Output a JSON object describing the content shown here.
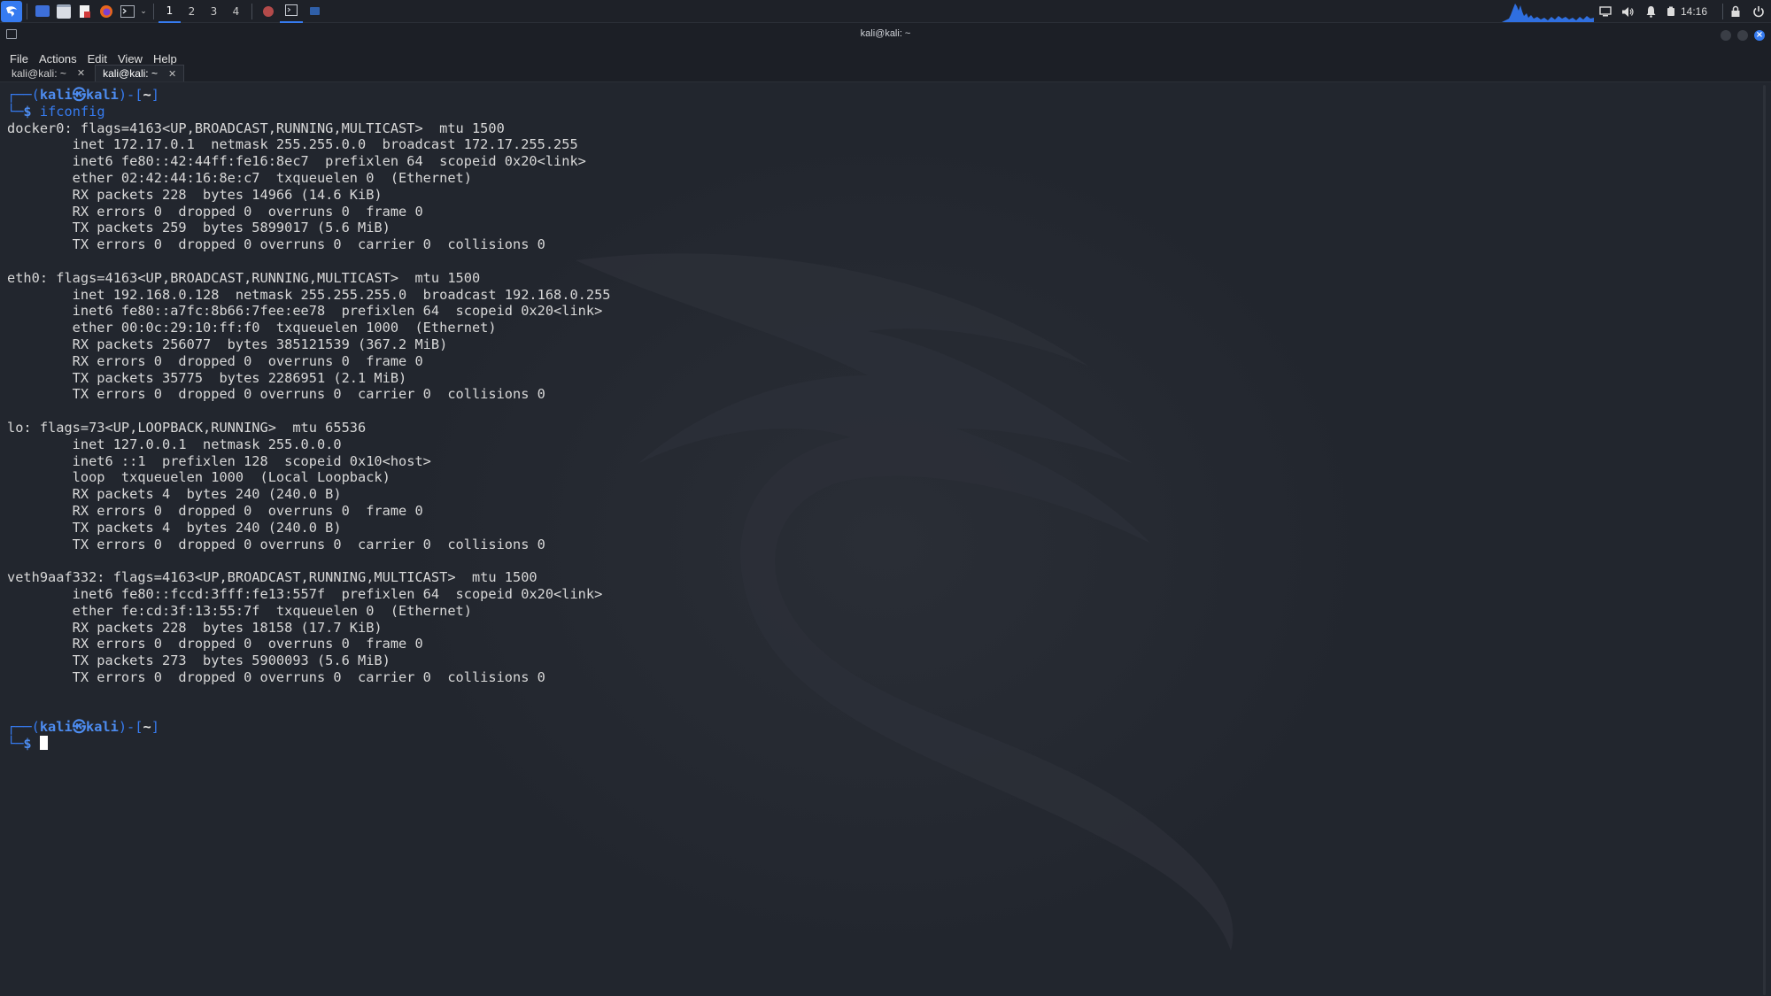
{
  "panel": {
    "workspaces": [
      "1",
      "2",
      "3",
      "4"
    ],
    "active_workspace": 0,
    "clock": "14:16",
    "colors": {
      "accent": "#367bf0",
      "background": "#1e2128"
    },
    "launchers": [
      "kali-menu-icon",
      "show-desktop-icon",
      "file-manager-icon",
      "text-editor-icon",
      "firefox-icon",
      "terminal-icon"
    ],
    "tray_icons": [
      "cpu-graph",
      "display-icon",
      "volume-icon",
      "notification-bell-icon",
      "battery-icon",
      "lock-icon",
      "power-icon"
    ]
  },
  "window": {
    "title": "kali@kali: ~",
    "menus": [
      "File",
      "Actions",
      "Edit",
      "View",
      "Help"
    ],
    "tabs": [
      {
        "label": "kali@kali: ~",
        "active": false
      },
      {
        "label": "kali@kali: ~",
        "active": true
      }
    ]
  },
  "terminal": {
    "prompt": {
      "user": "kali",
      "separator": "㉿",
      "host": "kali",
      "cwd": "~",
      "symbol": "$"
    },
    "command": "ifconfig",
    "output": [
      "docker0: flags=4163<UP,BROADCAST,RUNNING,MULTICAST>  mtu 1500",
      "        inet 172.17.0.1  netmask 255.255.0.0  broadcast 172.17.255.255",
      "        inet6 fe80::42:44ff:fe16:8ec7  prefixlen 64  scopeid 0x20<link>",
      "        ether 02:42:44:16:8e:c7  txqueuelen 0  (Ethernet)",
      "        RX packets 228  bytes 14966 (14.6 KiB)",
      "        RX errors 0  dropped 0  overruns 0  frame 0",
      "        TX packets 259  bytes 5899017 (5.6 MiB)",
      "        TX errors 0  dropped 0 overruns 0  carrier 0  collisions 0",
      "",
      "eth0: flags=4163<UP,BROADCAST,RUNNING,MULTICAST>  mtu 1500",
      "        inet 192.168.0.128  netmask 255.255.255.0  broadcast 192.168.0.255",
      "        inet6 fe80::a7fc:8b66:7fee:ee78  prefixlen 64  scopeid 0x20<link>",
      "        ether 00:0c:29:10:ff:f0  txqueuelen 1000  (Ethernet)",
      "        RX packets 256077  bytes 385121539 (367.2 MiB)",
      "        RX errors 0  dropped 0  overruns 0  frame 0",
      "        TX packets 35775  bytes 2286951 (2.1 MiB)",
      "        TX errors 0  dropped 0 overruns 0  carrier 0  collisions 0",
      "",
      "lo: flags=73<UP,LOOPBACK,RUNNING>  mtu 65536",
      "        inet 127.0.0.1  netmask 255.0.0.0",
      "        inet6 ::1  prefixlen 128  scopeid 0x10<host>",
      "        loop  txqueuelen 1000  (Local Loopback)",
      "        RX packets 4  bytes 240 (240.0 B)",
      "        RX errors 0  dropped 0  overruns 0  frame 0",
      "        TX packets 4  bytes 240 (240.0 B)",
      "        TX errors 0  dropped 0 overruns 0  carrier 0  collisions 0",
      "",
      "veth9aaf332: flags=4163<UP,BROADCAST,RUNNING,MULTICAST>  mtu 1500",
      "        inet6 fe80::fccd:3fff:fe13:557f  prefixlen 64  scopeid 0x20<link>",
      "        ether fe:cd:3f:13:55:7f  txqueuelen 0  (Ethernet)",
      "        RX packets 228  bytes 18158 (17.7 KiB)",
      "        RX errors 0  dropped 0  overruns 0  frame 0",
      "        TX packets 273  bytes 5900093 (5.6 MiB)",
      "        TX errors 0  dropped 0 overruns 0  carrier 0  collisions 0",
      "",
      ""
    ],
    "colors": {
      "background": "#22262e",
      "text": "#d8d8d8",
      "prompt": "#367bf0"
    }
  }
}
